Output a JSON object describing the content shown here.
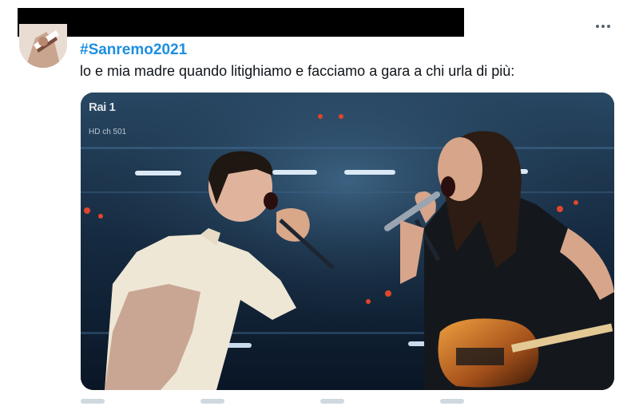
{
  "tweet": {
    "hashtag": "#Sanremo2021",
    "text": "lo e mia madre quando litighiamo e facciamo a gara a chi urla di più:",
    "more_icon": "more-horizontal-icon"
  },
  "media": {
    "channel_logo": "Rai 1",
    "channel_info": "HD ch 501"
  },
  "colors": {
    "hashtag": "#1d8fe0",
    "text": "#0f1419",
    "redaction": "#000000"
  }
}
